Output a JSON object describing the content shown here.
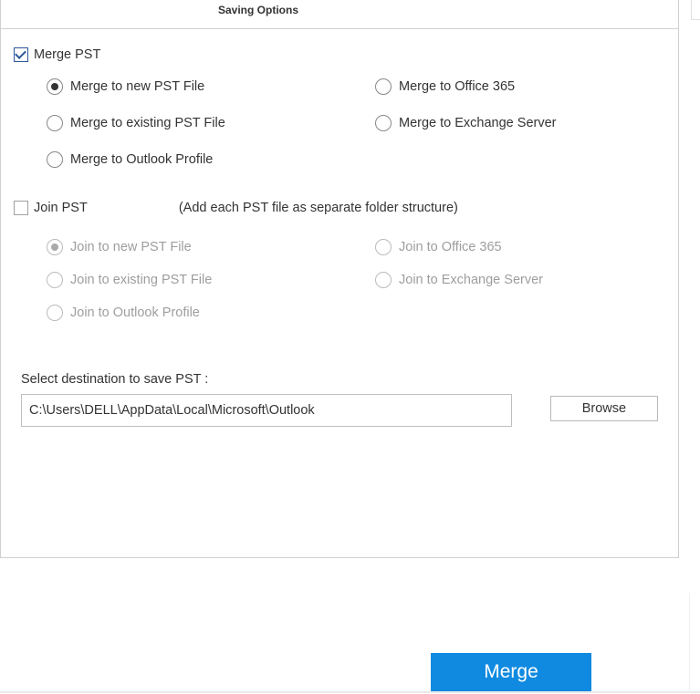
{
  "panel": {
    "title": "Saving Options"
  },
  "mergePst": {
    "label": "Merge PST",
    "checked": true,
    "options": [
      {
        "label": "Merge to new PST File",
        "selected": true
      },
      {
        "label": "Merge to Office 365",
        "selected": false
      },
      {
        "label": "Merge to existing PST File",
        "selected": false
      },
      {
        "label": "Merge to Exchange Server",
        "selected": false
      },
      {
        "label": "Merge to Outlook Profile",
        "selected": false
      }
    ]
  },
  "joinPst": {
    "label": "Join PST",
    "hint": "(Add each PST file as separate folder structure)",
    "checked": false,
    "options": [
      {
        "label": "Join to new PST File",
        "selected": true
      },
      {
        "label": "Join to Office 365",
        "selected": false
      },
      {
        "label": "Join to existing PST File",
        "selected": false
      },
      {
        "label": "Join to Exchange Server",
        "selected": false
      },
      {
        "label": "Join to Outlook Profile",
        "selected": false
      }
    ]
  },
  "destination": {
    "label": "Select destination to save PST :",
    "path": "C:\\Users\\DELL\\AppData\\Local\\Microsoft\\Outlook",
    "browse": "Browse"
  },
  "actions": {
    "merge": "Merge"
  }
}
